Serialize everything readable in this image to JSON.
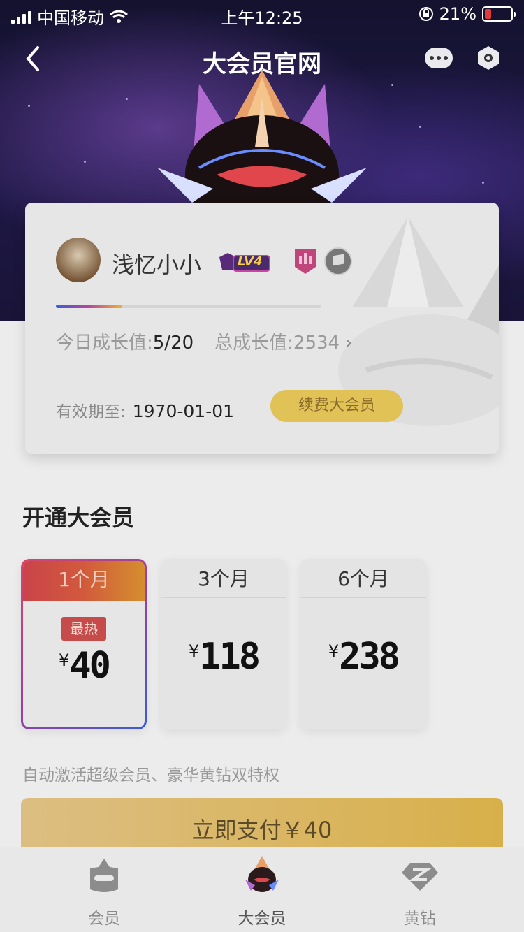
{
  "status_bar": {
    "carrier": "中国移动",
    "time": "上午12:25",
    "battery": "21%"
  },
  "nav": {
    "title": "大会员官网"
  },
  "profile": {
    "username": "浅忆小小",
    "level": "LV4",
    "progress_percent": 25,
    "today_growth_label": "今日成长值:",
    "today_growth_value": "5/20",
    "total_growth_label": "总成长值:",
    "total_growth_value": "2534",
    "expiry_label": "有效期至:",
    "expiry_date": "1970-01-01",
    "renew_button": "续费大会员"
  },
  "section": {
    "title": "开通大会员",
    "description": "自动激活超级会员、豪华黄钻双特权"
  },
  "plans": [
    {
      "period": "1个月",
      "currency": "¥",
      "price": "40",
      "tag": "最热",
      "selected": true
    },
    {
      "period": "3个月",
      "currency": "¥",
      "price": "118",
      "selected": false
    },
    {
      "period": "6个月",
      "currency": "¥",
      "price": "238",
      "selected": false
    }
  ],
  "pay_button": "立即支付￥40",
  "tabbar": {
    "tabs": [
      {
        "label": "会员"
      },
      {
        "label": "大会员"
      },
      {
        "label": "黄钻"
      }
    ],
    "active_index": 1
  },
  "colors": {
    "gold": "#d8b04a",
    "hot_tag": "#c64b4b",
    "hero_bg": "#1d1846"
  }
}
